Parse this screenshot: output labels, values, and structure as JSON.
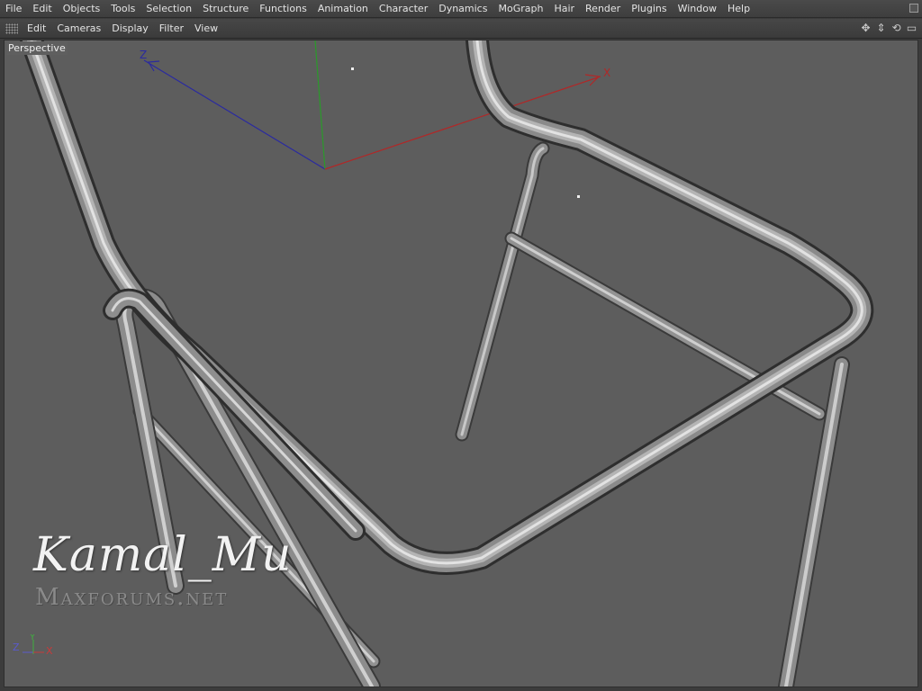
{
  "menubar": {
    "items": [
      "File",
      "Edit",
      "Objects",
      "Tools",
      "Selection",
      "Structure",
      "Functions",
      "Animation",
      "Character",
      "Dynamics",
      "MoGraph",
      "Hair",
      "Render",
      "Plugins",
      "Window",
      "Help"
    ]
  },
  "viewbar": {
    "items": [
      "Edit",
      "Cameras",
      "Display",
      "Filter",
      "View"
    ]
  },
  "viewport": {
    "label": "Perspective",
    "axis_labels": {
      "x": "X",
      "z": "Z"
    },
    "mini_axis": {
      "z": "Z",
      "y": "Y",
      "x": "X"
    }
  },
  "watermark": {
    "name": "Kamal_Mu",
    "site": "Maxforums.net"
  },
  "icons": {
    "nav": [
      "move-view-icon",
      "dolly-view-icon",
      "rotate-view-icon",
      "maximize-view-icon"
    ]
  },
  "colors": {
    "x_axis": "#b02828",
    "y_axis": "#2a9a2a",
    "z_axis": "#2a2aa0",
    "background": "#5d5d5d"
  }
}
